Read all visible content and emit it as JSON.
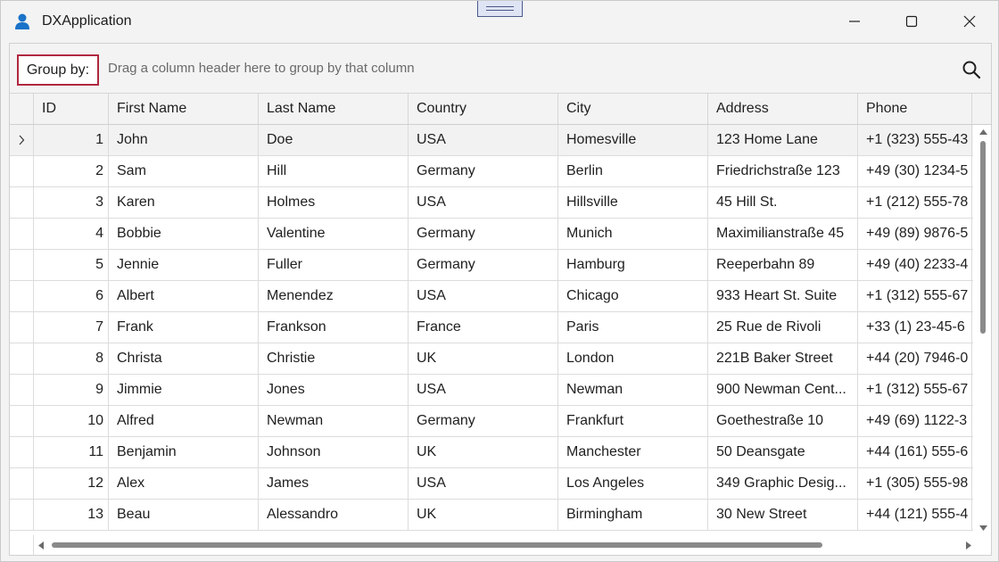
{
  "window": {
    "title": "DXApplication",
    "icons": {
      "app": "user-icon",
      "minimize": "minimize-icon",
      "maximize": "maximize-icon",
      "close": "close-icon"
    }
  },
  "group_panel": {
    "label": "Group by:",
    "hint": "Drag a column header here to group by that column",
    "search_icon": "search-icon",
    "accent_color": "#b0283f"
  },
  "columns": [
    "ID",
    "First Name",
    "Last Name",
    "Country",
    "City",
    "Address",
    "Phone"
  ],
  "rows": [
    [
      "1",
      "John",
      "Doe",
      "USA",
      "Homesville",
      "123 Home Lane",
      "+1 (323) 555-43"
    ],
    [
      "2",
      "Sam",
      "Hill",
      "Germany",
      "Berlin",
      "Friedrichstraße 123",
      "+49 (30) 1234-5"
    ],
    [
      "3",
      "Karen",
      "Holmes",
      "USA",
      "Hillsville",
      "45 Hill St.",
      "+1 (212) 555-78"
    ],
    [
      "4",
      "Bobbie",
      "Valentine",
      "Germany",
      "Munich",
      "Maximilianstraße 45",
      "+49 (89) 9876-5"
    ],
    [
      "5",
      "Jennie",
      "Fuller",
      "Germany",
      "Hamburg",
      "Reeperbahn 89",
      "+49 (40) 2233-4"
    ],
    [
      "6",
      "Albert",
      "Menendez",
      "USA",
      "Chicago",
      "933 Heart St. Suite",
      "+1 (312) 555-67"
    ],
    [
      "7",
      "Frank",
      "Frankson",
      "France",
      "Paris",
      "25 Rue de Rivoli",
      "+33 (1) 23-45-6"
    ],
    [
      "8",
      "Christa",
      "Christie",
      "UK",
      "London",
      "221B Baker Street",
      "+44 (20) 7946-0"
    ],
    [
      "9",
      "Jimmie",
      "Jones",
      "USA",
      "Newman",
      "900 Newman Cent...",
      "+1 (312) 555-67"
    ],
    [
      "10",
      "Alfred",
      "Newman",
      "Germany",
      "Frankfurt",
      "Goethestraße 10",
      "+49 (69) 1122-3"
    ],
    [
      "11",
      "Benjamin",
      "Johnson",
      "UK",
      "Manchester",
      " 50 Deansgate",
      "+44 (161) 555-6"
    ],
    [
      "12",
      "Alex",
      "James",
      "USA",
      "Los Angeles",
      "349 Graphic Desig...",
      "+1 (305) 555-98"
    ],
    [
      "13",
      "Beau",
      "Alessandro",
      "UK",
      "Birmingham",
      "30 New Street",
      "+44 (121) 555-4"
    ]
  ],
  "focused_row": 0,
  "row_indicator_icon": "chevron-right-icon",
  "scrollbars": {
    "vertical": {
      "up_icon": "scroll-up-arrow-icon",
      "down_icon": "scroll-down-arrow-icon"
    },
    "horizontal": {
      "left_icon": "scroll-left-arrow-icon",
      "right_icon": "scroll-right-arrow-icon"
    }
  }
}
